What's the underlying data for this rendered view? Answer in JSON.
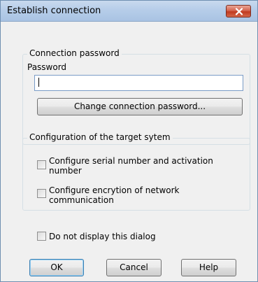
{
  "window": {
    "title": "Establish connection"
  },
  "connection_group": {
    "legend": "Connection password",
    "password_label": "Password",
    "password_value": "",
    "change_button": "Change connection password..."
  },
  "config_group": {
    "legend": "Configuration of the target sytem",
    "options": [
      {
        "label": "Configure serial number and activation number",
        "checked": false
      },
      {
        "label": "Configure encrytion of network communication",
        "checked": false
      }
    ]
  },
  "do_not_display": {
    "label": "Do not display this dialog",
    "checked": false
  },
  "buttons": {
    "ok": "OK",
    "cancel": "Cancel",
    "help": "Help"
  },
  "colors": {
    "close_button": "#c7442a",
    "title_bar": "#b9cfea",
    "input_border": "#7a9cc7"
  },
  "icons": {
    "close": "close-icon"
  }
}
